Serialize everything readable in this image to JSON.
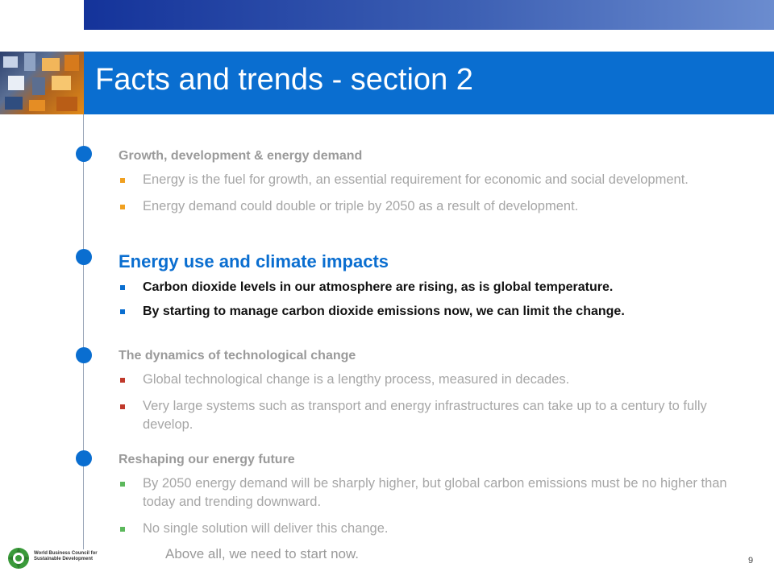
{
  "slide": {
    "title": "Facts and trends - section 2",
    "number": "9"
  },
  "colors": {
    "accent": "#0a6ed0",
    "band": "#14339a",
    "muted_text": "#a6a6a6",
    "active_text": "#111111",
    "bullet_orange": "#f0a020",
    "bullet_blue": "#0a6ed0",
    "bullet_red": "#c0392b",
    "bullet_green": "#5cb85c"
  },
  "sections": [
    {
      "heading": "Growth, development & energy demand",
      "bullets": [
        "Energy is the fuel for growth, an essential requirement for economic and social development.",
        "Energy demand could double or triple by 2050 as a result of development."
      ]
    },
    {
      "heading": "Energy use and climate impacts",
      "bullets": [
        "Carbon dioxide levels in our atmosphere are rising, as is global temperature.",
        "By starting to manage carbon dioxide emissions now, we can limit the change."
      ]
    },
    {
      "heading": "The dynamics of technological change",
      "bullets": [
        "Global technological change is a lengthy process, measured in decades.",
        "Very large systems such as transport and energy infrastructures can take up to a century to fully develop."
      ]
    },
    {
      "heading": "Reshaping our energy future",
      "bullets": [
        "By 2050 energy demand will be sharply higher, but global carbon emissions must be no higher than today and trending downward.",
        "No single solution will deliver this change."
      ]
    }
  ],
  "closing": "Above all, we need to start now.",
  "logo": {
    "line1": "World Business Council for",
    "line2": "Sustainable Development"
  }
}
